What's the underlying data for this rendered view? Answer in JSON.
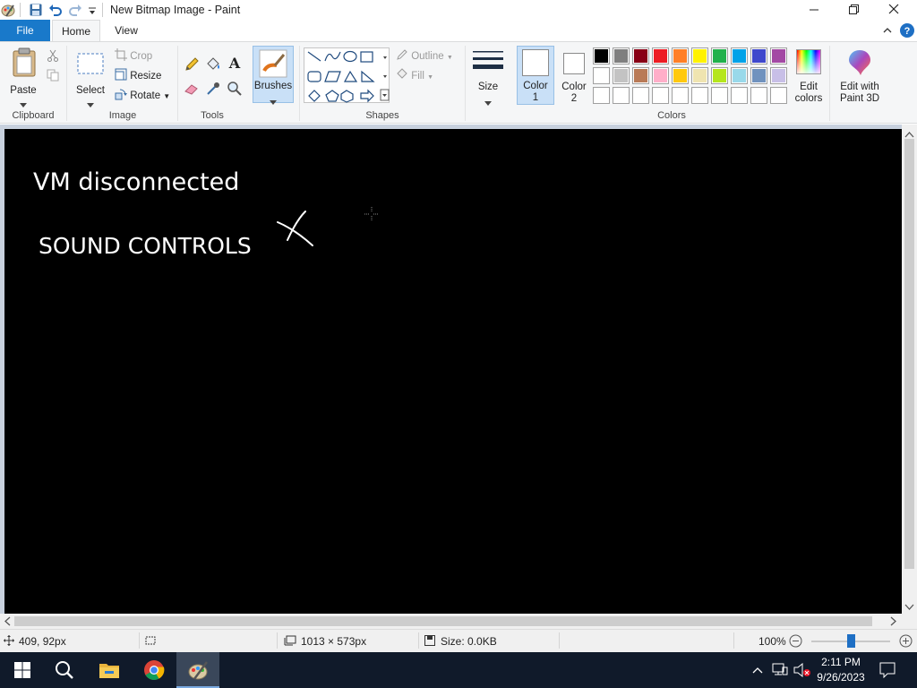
{
  "window": {
    "title": "New Bitmap Image - Paint",
    "minimize_icon": "minimize-icon",
    "maximize_icon": "restore-icon",
    "close_icon": "close-icon"
  },
  "quick_access": [
    "paint-app-icon",
    "save-icon",
    "undo-icon",
    "redo-icon",
    "customize-quick-access-icon"
  ],
  "tabs": {
    "file": "File",
    "home": "Home",
    "view": "View"
  },
  "ribbon": {
    "clipboard": {
      "label": "Clipboard",
      "paste": "Paste"
    },
    "image": {
      "label": "Image",
      "select": "Select",
      "crop": "Crop",
      "resize": "Resize",
      "rotate": "Rotate"
    },
    "tools": {
      "label": "Tools"
    },
    "brushes": {
      "label": "Brushes"
    },
    "shapes": {
      "label": "Shapes",
      "outline": "Outline",
      "fill": "Fill"
    },
    "size": {
      "label": "Size"
    },
    "color1": {
      "label": "Color\n1",
      "line1": "Color",
      "line2": "1"
    },
    "color2": {
      "line1": "Color",
      "line2": "2"
    },
    "colors": {
      "label": "Colors",
      "row1": [
        "#000000",
        "#7f7f7f",
        "#880015",
        "#ed1c24",
        "#ff7f27",
        "#fff200",
        "#22b14c",
        "#00a2e8",
        "#3f48cc",
        "#a349a4"
      ],
      "row2": [
        "#ffffff",
        "#c3c3c3",
        "#b97a57",
        "#ffaec9",
        "#ffc90e",
        "#efe4b0",
        "#b5e61d",
        "#99d9ea",
        "#7092be",
        "#c8bfe7"
      ]
    },
    "edit_colors": {
      "line1": "Edit",
      "line2": "colors"
    },
    "paint3d": {
      "line1": "Edit with",
      "line2": "Paint 3D"
    }
  },
  "canvas": {
    "background": "#000000",
    "text1": "VM disconnected",
    "text2": "SOUND CONTROLS"
  },
  "status": {
    "cursor_pos": "409, 92px",
    "image_size": "1013 × 573px",
    "file_size": "Size: 0.0KB",
    "zoom": "100%"
  },
  "taskbar": {
    "time": "2:11 PM",
    "date": "9/26/2023"
  }
}
